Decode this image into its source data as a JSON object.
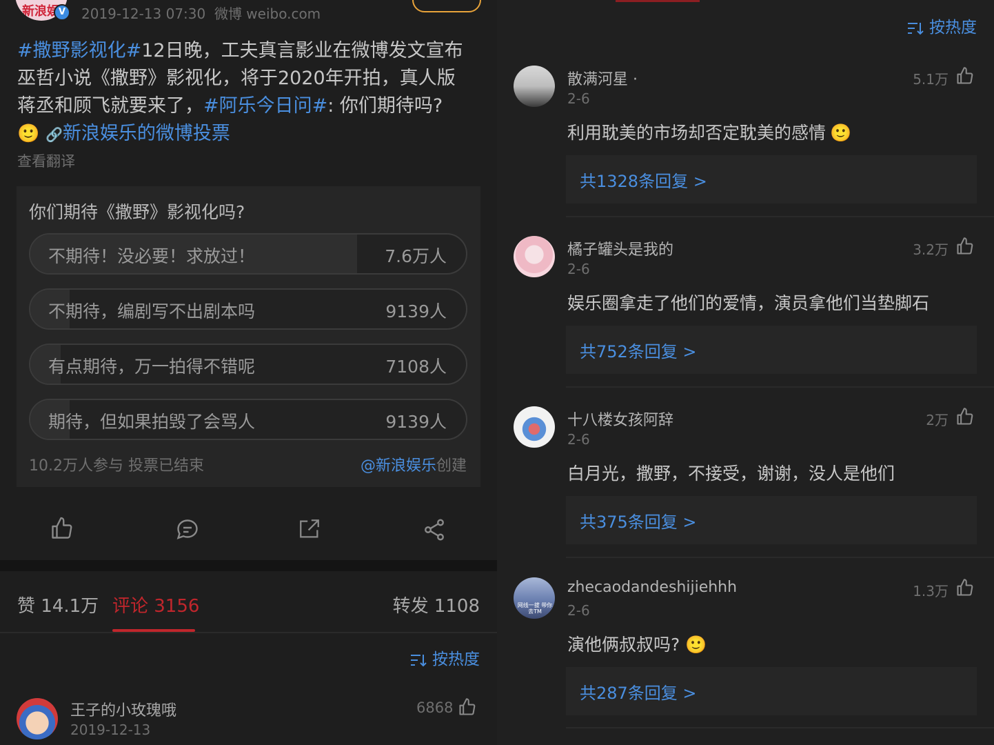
{
  "left": {
    "post_meta": "2019-12-13 07:30  微博 weibo.com",
    "verified_badge": "V",
    "avatar_text": "新浪娱",
    "body": {
      "tag1": "#撒野影视化#",
      "line1_rest": "12日晚，工夫真言影业在微博发文宣布",
      "line2": "巫哲小说《撒野》影视化，将于2020年开拍，真人版",
      "line3_a": "蒋丞和顾飞就要来了，",
      "tag2": "#阿乐今日问#",
      "line3_b": ": 你们期待吗?",
      "emoji": "🙂",
      "link_icon": "🔗",
      "link_text": "新浪娱乐的微博投票"
    },
    "translate": "查看翻译",
    "poll": {
      "question": "你们期待《撒野》影视化吗?",
      "options": [
        {
          "label": "不期待！没必要！求放过！",
          "count": "7.6万人",
          "share": 0.75
        },
        {
          "label": "不期待，编剧写不出剧本吗",
          "count": "9139人",
          "share": 0.09
        },
        {
          "label": "有点期待，万一拍得不错呢",
          "count": "7108人",
          "share": 0.07
        },
        {
          "label": "期待，但如果拍毁了会骂人",
          "count": "9139人",
          "share": 0.09
        }
      ],
      "summary": "10.2万人参与 投票已结束",
      "creator_link": "@新浪娱乐",
      "creator_suffix": "创建"
    },
    "actions": {
      "like_icon": "thumb-up-icon",
      "comment_icon": "comment-icon",
      "repost_icon": "repost-icon",
      "share_icon": "share-icon"
    },
    "stats": {
      "likes": "赞 14.1万",
      "comments": "评论 3156",
      "reposts": "转发 1108"
    },
    "sort_label": "按热度",
    "comment": {
      "username": "王子的小玫瑰哦",
      "date": "2019-12-13",
      "likes": "6868"
    }
  },
  "right": {
    "sort_label": "按热度",
    "comments": [
      {
        "username": "散满河星 ·",
        "date": "2-6",
        "likes": "5.1万",
        "text": "利用耽美的市场却否定耽美的感情",
        "emoji": "🙂",
        "replies": "共1328条回复 >"
      },
      {
        "username": "橘子罐头是我的",
        "date": "2-6",
        "likes": "3.2万",
        "text": "娱乐圈拿走了他们的爱情，演员拿他们当垫脚石",
        "emoji": "",
        "replies": "共752条回复 >"
      },
      {
        "username": "十八楼女孩阿辞",
        "date": "2-6",
        "likes": "2万",
        "text": "白月光，撒野，不接受，谢谢，没人是他们",
        "emoji": "",
        "replies": "共375条回复 >"
      },
      {
        "username": "zhecaodandeshijiehhh",
        "date": "2-6",
        "likes": "1.3万",
        "text": "演他俩叔叔吗?",
        "emoji": "🙂",
        "replies": "共287条回复 >"
      }
    ],
    "avatar4_text": "网线一拔 带你去TM"
  },
  "colors": {
    "accent_blue": "#4a8fe0",
    "active_red": "#c0262c",
    "verified_blue": "#3b8be0"
  }
}
